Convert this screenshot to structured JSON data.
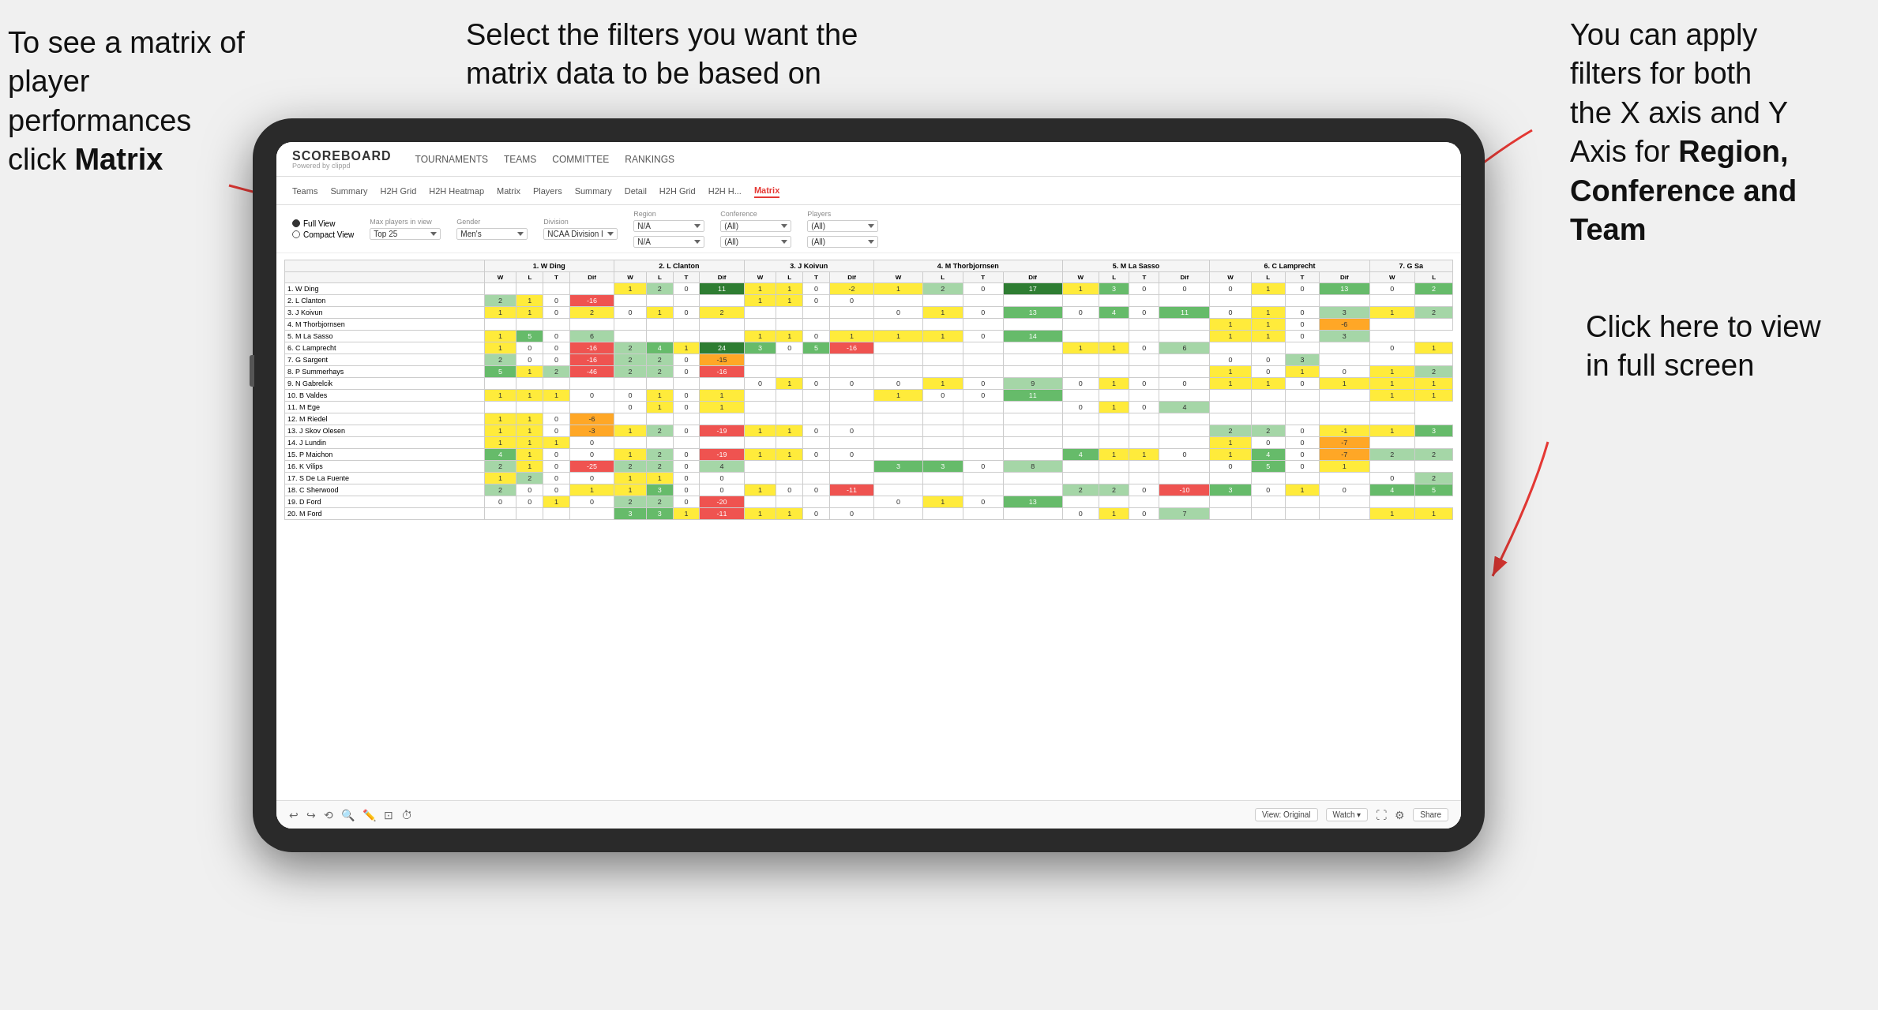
{
  "annotations": {
    "left": {
      "line1": "To see a matrix of",
      "line2": "player performances",
      "line3_normal": "click ",
      "line3_bold": "Matrix"
    },
    "center": {
      "text": "Select the filters you want the matrix data to be based on"
    },
    "right": {
      "line1": "You  can apply",
      "line2": "filters for both",
      "line3": "the X axis and Y",
      "line4_normal": "Axis for ",
      "line4_bold": "Region,",
      "line5_bold": "Conference and",
      "line6_bold": "Team"
    },
    "bottom_right": {
      "line1": "Click here to view",
      "line2": "in full screen"
    }
  },
  "nav": {
    "brand_name": "SCOREBOARD",
    "brand_sub": "Powered by clippd",
    "items": [
      "TOURNAMENTS",
      "TEAMS",
      "COMMITTEE",
      "RANKINGS"
    ]
  },
  "sub_tabs": {
    "tabs": [
      "Teams",
      "Summary",
      "H2H Grid",
      "H2H Heatmap",
      "Matrix",
      "Players",
      "Summary",
      "Detail",
      "H2H Grid",
      "H2H H...",
      "Matrix"
    ],
    "active": "Matrix"
  },
  "filters": {
    "view_options": [
      "Full View",
      "Compact View"
    ],
    "active_view": "Full View",
    "max_players_label": "Max players in view",
    "max_players_value": "Top 25",
    "gender_label": "Gender",
    "gender_value": "Men's",
    "division_label": "Division",
    "division_value": "NCAA Division I",
    "region_label": "Region",
    "region_value": "N/A",
    "region_value2": "N/A",
    "conference_label": "Conference",
    "conference_value": "(All)",
    "conference_value2": "(All)",
    "players_label": "Players",
    "players_value": "(All)",
    "players_value2": "(All)"
  },
  "matrix": {
    "col_headers": [
      "1. W Ding",
      "2. L Clanton",
      "3. J Koivun",
      "4. M Thorbjornsen",
      "5. M La Sasso",
      "6. C Lamprecht",
      "7. G Sa"
    ],
    "sub_cols": [
      "W",
      "L",
      "T",
      "Dif"
    ],
    "rows": [
      {
        "name": "1. W Ding",
        "cells": [
          "",
          "",
          "",
          "",
          "1",
          "2",
          "0",
          "11",
          "1",
          "1",
          "0",
          "-2",
          "1",
          "2",
          "0",
          "17",
          "1",
          "3",
          "0",
          "0",
          "0",
          "1",
          "0",
          "13",
          "0",
          "2"
        ]
      },
      {
        "name": "2. L Clanton",
        "cells": [
          "2",
          "1",
          "0",
          "-16",
          "",
          "",
          "",
          "",
          "1",
          "1",
          "0",
          "0",
          "",
          "",
          "",
          "",
          "",
          "",
          "",
          "",
          "",
          "",
          "",
          "",
          "",
          ""
        ]
      },
      {
        "name": "3. J Koivun",
        "cells": [
          "1",
          "1",
          "0",
          "2",
          "0",
          "1",
          "0",
          "2",
          "",
          "",
          "",
          "",
          "0",
          "1",
          "0",
          "13",
          "0",
          "4",
          "0",
          "11",
          "0",
          "1",
          "0",
          "3",
          "1",
          "2"
        ]
      },
      {
        "name": "4. M Thorbjornsen",
        "cells": [
          "",
          "",
          "",
          "",
          "",
          "",
          "",
          "",
          "",
          "",
          "",
          "",
          "",
          "",
          "",
          "",
          "",
          "",
          "",
          "",
          "1",
          "1",
          "0",
          "-6",
          "",
          ""
        ]
      },
      {
        "name": "5. M La Sasso",
        "cells": [
          "1",
          "5",
          "0",
          "6",
          "",
          "",
          "",
          "",
          "1",
          "1",
          "0",
          "1",
          "1",
          "1",
          "0",
          "14",
          "",
          "",
          "",
          "",
          "1",
          "1",
          "0",
          "3",
          ""
        ]
      },
      {
        "name": "6. C Lamprecht",
        "cells": [
          "1",
          "0",
          "0",
          "-16",
          "2",
          "4",
          "1",
          "24",
          "3",
          "0",
          "5",
          "-16",
          "",
          "",
          "",
          "",
          "1",
          "1",
          "0",
          "6",
          "",
          "",
          "",
          "",
          "0",
          "1"
        ]
      },
      {
        "name": "7. G Sargent",
        "cells": [
          "2",
          "0",
          "0",
          "-16",
          "2",
          "2",
          "0",
          "-15",
          "",
          "",
          "",
          "",
          "",
          "",
          "",
          "",
          "",
          "",
          "",
          "",
          "0",
          "0",
          "3",
          "",
          "",
          ""
        ]
      },
      {
        "name": "8. P Summerhays",
        "cells": [
          "5",
          "1",
          "2",
          "-46",
          "2",
          "2",
          "0",
          "-16",
          "",
          "",
          "",
          "",
          "",
          "",
          "",
          "",
          "",
          "",
          "",
          "",
          "1",
          "0",
          "1",
          "0",
          "1",
          "2"
        ]
      },
      {
        "name": "9. N Gabrelcik",
        "cells": [
          "",
          "",
          "",
          "",
          "",
          "",
          "",
          "",
          "0",
          "1",
          "0",
          "0",
          "0",
          "1",
          "0",
          "9",
          "0",
          "1",
          "0",
          "0",
          "1",
          "1",
          "0",
          "1",
          "1",
          "1"
        ]
      },
      {
        "name": "10. B Valdes",
        "cells": [
          "1",
          "1",
          "1",
          "0",
          "0",
          "1",
          "0",
          "1",
          "",
          "",
          "",
          "",
          "1",
          "0",
          "0",
          "11",
          "",
          "",
          "",
          "",
          "",
          "",
          "",
          "",
          "1",
          "1"
        ]
      },
      {
        "name": "11. M Ege",
        "cells": [
          "",
          "",
          "",
          "",
          "0",
          "1",
          "0",
          "1",
          "",
          "",
          "",
          "",
          "",
          "",
          "",
          "",
          "0",
          "1",
          "0",
          "4",
          "",
          "",
          "",
          "",
          ""
        ]
      },
      {
        "name": "12. M Riedel",
        "cells": [
          "1",
          "1",
          "0",
          "-6",
          "",
          "",
          "",
          "",
          "",
          "",
          "",
          "",
          "",
          "",
          "",
          "",
          "",
          "",
          "",
          "",
          "",
          "",
          "",
          "",
          ""
        ]
      },
      {
        "name": "13. J Skov Olesen",
        "cells": [
          "1",
          "1",
          "0",
          "-3",
          "1",
          "2",
          "0",
          "-19",
          "1",
          "1",
          "0",
          "0",
          "",
          "",
          "",
          "",
          "",
          "",
          "",
          "",
          "2",
          "2",
          "0",
          "-1",
          "1",
          "3"
        ]
      },
      {
        "name": "14. J Lundin",
        "cells": [
          "1",
          "1",
          "1",
          "0",
          "",
          "",
          "",
          "",
          "",
          "",
          "",
          "",
          "",
          "",
          "",
          "",
          "",
          "",
          "",
          "",
          "1",
          "0",
          "0",
          "-7",
          ""
        ]
      },
      {
        "name": "15. P Maichon",
        "cells": [
          "4",
          "1",
          "0",
          "0",
          "1",
          "2",
          "0",
          "-19",
          "1",
          "1",
          "0",
          "0",
          "",
          "",
          "",
          "",
          "4",
          "1",
          "1",
          "0",
          "1",
          "4",
          "0",
          "-7",
          "2",
          "2"
        ]
      },
      {
        "name": "16. K Vilips",
        "cells": [
          "2",
          "1",
          "0",
          "-25",
          "2",
          "2",
          "0",
          "4",
          "",
          "",
          "",
          "",
          "3",
          "3",
          "0",
          "8",
          "",
          "",
          "",
          "",
          "0",
          "5",
          "0",
          "1",
          ""
        ]
      },
      {
        "name": "17. S De La Fuente",
        "cells": [
          "1",
          "2",
          "0",
          "0",
          "1",
          "1",
          "0",
          "0",
          "",
          "",
          "",
          "",
          "",
          "",
          "",
          "",
          "",
          "",
          "",
          "",
          "",
          "",
          "",
          "",
          "0",
          "2"
        ]
      },
      {
        "name": "18. C Sherwood",
        "cells": [
          "2",
          "0",
          "0",
          "1",
          "1",
          "3",
          "0",
          "0",
          "1",
          "0",
          "0",
          "-11",
          "",
          "",
          "",
          "",
          "2",
          "2",
          "0",
          "-10",
          "3",
          "0",
          "1",
          "0",
          "4",
          "5"
        ]
      },
      {
        "name": "19. D Ford",
        "cells": [
          "0",
          "0",
          "1",
          "0",
          "2",
          "2",
          "0",
          "-20",
          "",
          "",
          "",
          "",
          "0",
          "1",
          "0",
          "13",
          "",
          "",
          "",
          "",
          "",
          "",
          "",
          "",
          ""
        ]
      },
      {
        "name": "20. M Ford",
        "cells": [
          "",
          "",
          "",
          "",
          "3",
          "3",
          "1",
          "-11",
          "1",
          "1",
          "0",
          "0",
          "",
          "",
          "",
          "",
          "0",
          "1",
          "0",
          "7",
          "",
          "",
          "",
          "",
          "1",
          "1"
        ]
      }
    ]
  },
  "toolbar": {
    "icons": [
      "undo",
      "redo",
      "undo2",
      "zoom",
      "annotate",
      "zoom-fit",
      "timer"
    ],
    "view_label": "View: Original",
    "watch_label": "Watch ▾",
    "fullscreen_label": "Share"
  },
  "colors": {
    "accent": "#e53935",
    "brand": "#333"
  }
}
